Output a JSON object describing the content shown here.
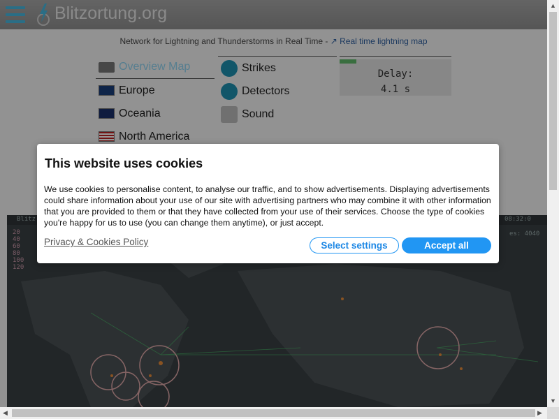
{
  "header": {
    "site_title": "Blitzortung.org"
  },
  "tagline": {
    "text": "Network for Lightning and Thunderstorms in Real Time - ",
    "link": "Real time lightning map"
  },
  "nav": {
    "regions": [
      "Overview Map",
      "Europe",
      "Oceania",
      "North America"
    ],
    "tools": [
      "Strikes",
      "Detectors",
      "Sound"
    ]
  },
  "delay": {
    "label": "Delay:",
    "value": "4.1 s"
  },
  "map_top": {
    "left": "Blitz",
    "right": "08:32:0",
    "stats": "es: 4040"
  },
  "legend": [
    "20",
    "40",
    "60",
    "80",
    "100",
    "120"
  ],
  "cookie": {
    "title": "This website uses cookies",
    "body": "We use cookies to personalise content, to analyse our traffic, and to show advertisements. Displaying advertisements could share information about your use of our site with advertising partners who may combine it with other information that you are provided to them or that they have collected from your use of their services. Choose the type of cookies you're happy for us to use (you can change them anytime), or just accept.",
    "policy_link": "Privacy & Cookies Policy",
    "select_settings": "Select settings",
    "accept_all": "Accept all"
  },
  "colors": {
    "accent": "#2196f3",
    "menu_icon": "#47b7e0",
    "delay_bar": "#5fb76a"
  }
}
